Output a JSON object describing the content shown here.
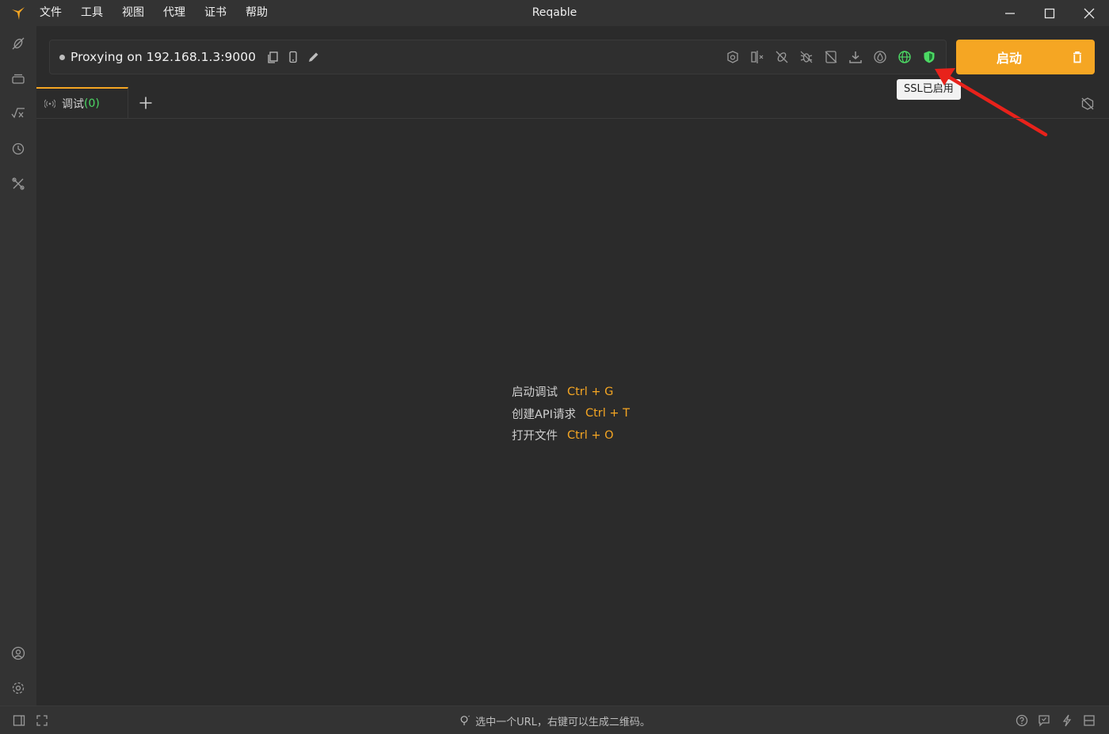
{
  "window": {
    "title": "Reqable",
    "menu": [
      "文件",
      "工具",
      "视图",
      "代理",
      "证书",
      "帮助"
    ]
  },
  "proxy": {
    "status_text": "Proxying on 192.168.1.3:9000"
  },
  "start_button": {
    "label": "启动"
  },
  "tooltip": {
    "text": "SSL已启用"
  },
  "tabs": [
    {
      "label": "调试",
      "count": "(0)"
    }
  ],
  "shortcuts": [
    {
      "label": "启动调试",
      "keys": "Ctrl + G"
    },
    {
      "label": "创建API请求",
      "keys": "Ctrl + T"
    },
    {
      "label": "打开文件",
      "keys": "Ctrl + O"
    }
  ],
  "statusbar": {
    "hint": "选中一个URL，右键可以生成二维码。"
  },
  "colors": {
    "accent": "#f5a623",
    "success": "#4cd964",
    "annotation_arrow": "#e8221b"
  }
}
